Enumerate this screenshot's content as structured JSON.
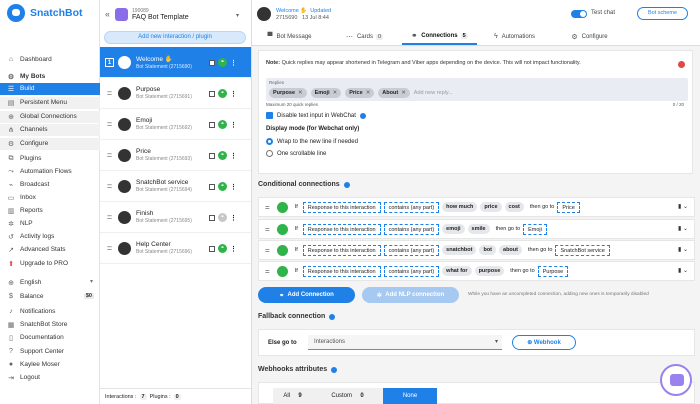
{
  "sidebar": {
    "brand": "SnatchBot",
    "items": [
      {
        "label": "Dashboard",
        "icon": "home-icon",
        "glyph": "⌂"
      },
      {
        "label": "My Bots",
        "icon": "robot-icon",
        "glyph": "⚙"
      },
      {
        "label": "Build",
        "icon": "list-icon",
        "glyph": "☰"
      },
      {
        "label": "Persistent Menu",
        "icon": "menu-icon",
        "glyph": "▤"
      },
      {
        "label": "Global Connections",
        "icon": "globe-icon",
        "glyph": "⊕"
      },
      {
        "label": "Channels",
        "icon": "channels-icon",
        "glyph": "⋔"
      },
      {
        "label": "Configure",
        "icon": "gear-icon",
        "glyph": "⚙"
      },
      {
        "label": "Plugins",
        "icon": "plugin-icon",
        "glyph": "⧉"
      },
      {
        "label": "Automation Flows",
        "icon": "flow-icon",
        "glyph": "⤳"
      },
      {
        "label": "Broadcast",
        "icon": "broadcast-icon",
        "glyph": "⌁"
      },
      {
        "label": "Inbox",
        "icon": "inbox-icon",
        "glyph": "▭"
      },
      {
        "label": "Reports",
        "icon": "reports-icon",
        "glyph": "▥"
      },
      {
        "label": "NLP",
        "icon": "nlp-icon",
        "glyph": "✲"
      },
      {
        "label": "Activity logs",
        "icon": "history-icon",
        "glyph": "↺"
      },
      {
        "label": "Advanced Stats",
        "icon": "stats-icon",
        "glyph": "↗"
      },
      {
        "label": "Upgrade to PRO",
        "icon": "upgrade-icon",
        "glyph": "⬆"
      },
      {
        "label": "English",
        "icon": "language-icon",
        "glyph": "⊕"
      },
      {
        "label": "Balance",
        "icon": "dollar-icon",
        "glyph": "$",
        "value": "$0"
      },
      {
        "label": "Notifications",
        "icon": "bell-icon",
        "glyph": "♪"
      },
      {
        "label": "SnatchBot Store",
        "icon": "store-icon",
        "glyph": "▦"
      },
      {
        "label": "Documentation",
        "icon": "book-icon",
        "glyph": "▯"
      },
      {
        "label": "Support Center",
        "icon": "support-icon",
        "glyph": "?"
      },
      {
        "label": "Kaylee Moser",
        "icon": "user-icon",
        "glyph": "●"
      },
      {
        "label": "Logout",
        "icon": "logout-icon",
        "glyph": "⇥"
      }
    ]
  },
  "bot": {
    "id": "190089",
    "name": "FAQ Bot Template"
  },
  "add_interaction_label": "Add new interaction / plugin",
  "interactions": [
    {
      "num": "1",
      "name": "Welcome ✋",
      "sub": "Bot Statement (2715690)"
    },
    {
      "name": "Purpose",
      "sub": "Bot Statement (2715691)"
    },
    {
      "name": "Emoji",
      "sub": "Bot Statement (2715692)"
    },
    {
      "name": "Price",
      "sub": "Bot Statement (2715693)"
    },
    {
      "name": "SnatchBot service",
      "sub": "Bot Statement (2715694)"
    },
    {
      "name": "Finish",
      "sub": "Bot Statement (2715695)"
    },
    {
      "name": "Help Center",
      "sub": "Bot Statement (2715696)"
    }
  ],
  "footer": {
    "interactions_label": "Interactions :",
    "interactions": "7",
    "plugins_label": "Plugins :",
    "plugins": "0"
  },
  "header": {
    "title": "Welcome ✋",
    "id": "2715690",
    "updated_label": "Updated",
    "updated": "13 Jul 8:44",
    "test_chat": "Test chat",
    "scheme": "Bot scheme"
  },
  "tabs": [
    {
      "label": "Bot Message",
      "icon": "message-icon",
      "glyph": "▀"
    },
    {
      "label": "Cards",
      "icon": "cards-icon",
      "glyph": "⋯",
      "badge": "0"
    },
    {
      "label": "Connections",
      "icon": "link-icon",
      "glyph": "⚭",
      "badge": "5"
    },
    {
      "label": "Automations",
      "icon": "bolt-icon",
      "glyph": "ϟ"
    },
    {
      "label": "Configure",
      "icon": "gear-icon",
      "glyph": "⚙"
    }
  ],
  "replies": {
    "note_bold": "Note:",
    "note": "Quick replies may appear shortened in Telegram and Viber apps depending on the device. This will not impact functionality.",
    "label": "Replies",
    "chips": [
      "Purpose",
      "Emoji",
      "Price",
      "About"
    ],
    "placeholder": "Add new reply...",
    "max": "Maximum 20 quick replies",
    "count": "0 / 20",
    "disable_text": "Disable text input in WebChat",
    "display_mode": "Display mode (for Webchat only)",
    "opt1": "Wrap to the new line if needed",
    "opt2": "One scrollable line"
  },
  "conditional": {
    "title": "Conditional connections",
    "rows": [
      {
        "words": [
          "how much",
          "price",
          "cost"
        ],
        "target": "Price"
      },
      {
        "words": [
          "emoji",
          "smile"
        ],
        "target": "Emoji"
      },
      {
        "words": [
          "snatchbot",
          "bot",
          "about"
        ],
        "target": "SnatchBot service"
      },
      {
        "words": [
          "what for",
          "purpose"
        ],
        "target": "Purpose"
      }
    ],
    "if": "If",
    "field": "Response to this interaction",
    "op": "contains (any part)",
    "goto": "then go to"
  },
  "add_connection": "Add Connection",
  "add_nlp": "Add NLP connection",
  "unsaved_note": "While you have an uncompleted connection, adding new ones is temporarily disabled",
  "fallback": {
    "title": "Fallback connection",
    "else": "Else go to",
    "select": "Interactions",
    "webhook": "Webhook"
  },
  "webhooks": {
    "title": "Webhooks attributes",
    "all": "All",
    "all_n": "9",
    "custom": "Custom",
    "custom_n": "0",
    "none": "None"
  },
  "colors": {
    "accent": "#1f80e8",
    "green": "#2fb34a"
  }
}
